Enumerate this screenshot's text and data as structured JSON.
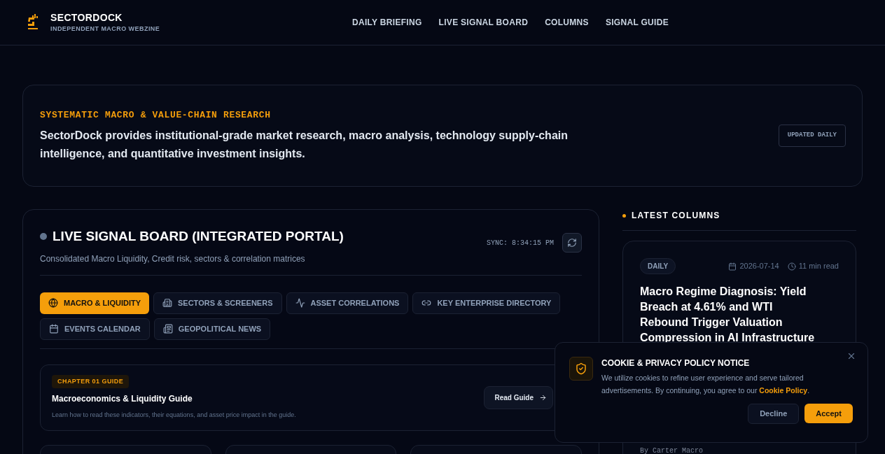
{
  "brand": {
    "name": "SECTORDOCK",
    "tagline": "INDEPENDENT MACRO WEBZINE"
  },
  "nav": [
    "DAILY BRIEFING",
    "LIVE SIGNAL BOARD",
    "COLUMNS",
    "SIGNAL GUIDE"
  ],
  "hero": {
    "eyebrow": "SYSTEMATIC MACRO & VALUE-CHAIN RESEARCH",
    "text": "SectorDock provides institutional-grade market research, macro analysis, technology supply-chain intelligence, and quantitative investment insights.",
    "badge": "UPDATED DAILY"
  },
  "board": {
    "title": "LIVE SIGNAL BOARD (INTEGRATED PORTAL)",
    "subtitle": "Consolidated Macro Liquidity, Credit risk, sectors & correlation matrices",
    "sync": "SYNC: 8:34:15 PM",
    "tabs": [
      {
        "label": "MACRO & LIQUIDITY",
        "selected": true
      },
      {
        "label": "SECTORS & SCREENERS",
        "selected": false
      },
      {
        "label": "ASSET CORRELATIONS",
        "selected": false
      },
      {
        "label": "KEY ENTERPRISE DIRECTORY",
        "selected": false
      },
      {
        "label": "EVENTS CALENDAR",
        "selected": false
      },
      {
        "label": "GEOPOLITICAL NEWS",
        "selected": false
      }
    ],
    "guide": {
      "badge": "CHAPTER 01 GUIDE",
      "title": "Macroeconomics & Liquidity Guide",
      "text": "Learn how to read these indicators, their equations, and asset price impact in the guide.",
      "button": "Read Guide"
    }
  },
  "sidebar": {
    "heading": "LATEST COLUMNS",
    "column": {
      "tag": "DAILY",
      "date": "2026-07-14",
      "read_time": "11 min read",
      "title": "Macro Regime Diagnosis: Yield Breach at 4.61% and WTI Rebound Trigger Valuation Compression in AI Infrastructure",
      "author": "By Carter Macro"
    }
  },
  "cookie": {
    "title": "COOKIE & PRIVACY POLICY NOTICE",
    "text": "We utilize cookies to refine user experience and serve tailored advertisements. By continuing, you agree to our",
    "link": "Cookie Policy",
    "after": ".",
    "buttons": [
      "Decline",
      "Accept"
    ]
  }
}
